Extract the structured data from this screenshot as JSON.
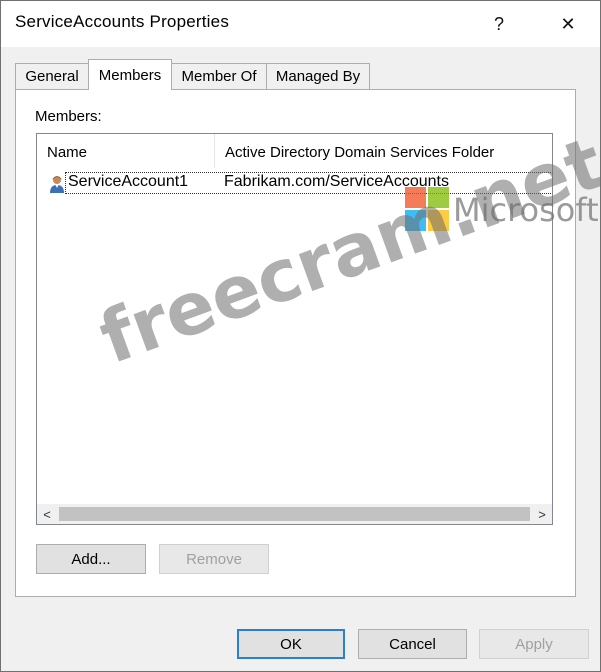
{
  "window": {
    "title": "ServiceAccounts Properties",
    "help_glyph": "?",
    "close_glyph": "✕"
  },
  "tabs": [
    {
      "label": "General",
      "active": false
    },
    {
      "label": "Members",
      "active": true
    },
    {
      "label": "Member Of",
      "active": false
    },
    {
      "label": "Managed By",
      "active": false
    }
  ],
  "members": {
    "label": "Members:",
    "columns": [
      "Name",
      "Active Directory Domain Services Folder"
    ],
    "rows": [
      {
        "name": "ServiceAccount1",
        "folder": "Fabrikam.com/ServiceAccounts",
        "icon": "user-icon"
      }
    ]
  },
  "scrollbar": {
    "left_arrow": "<",
    "right_arrow": ">"
  },
  "buttons": {
    "add": "Add...",
    "remove": "Remove",
    "ok": "OK",
    "cancel": "Cancel",
    "apply": "Apply"
  },
  "watermark": {
    "text": "freecram.net",
    "brand": "Microsoft",
    "logo_colors": [
      "#f25022",
      "#7fba00",
      "#00a4ef",
      "#ffb900"
    ]
  }
}
